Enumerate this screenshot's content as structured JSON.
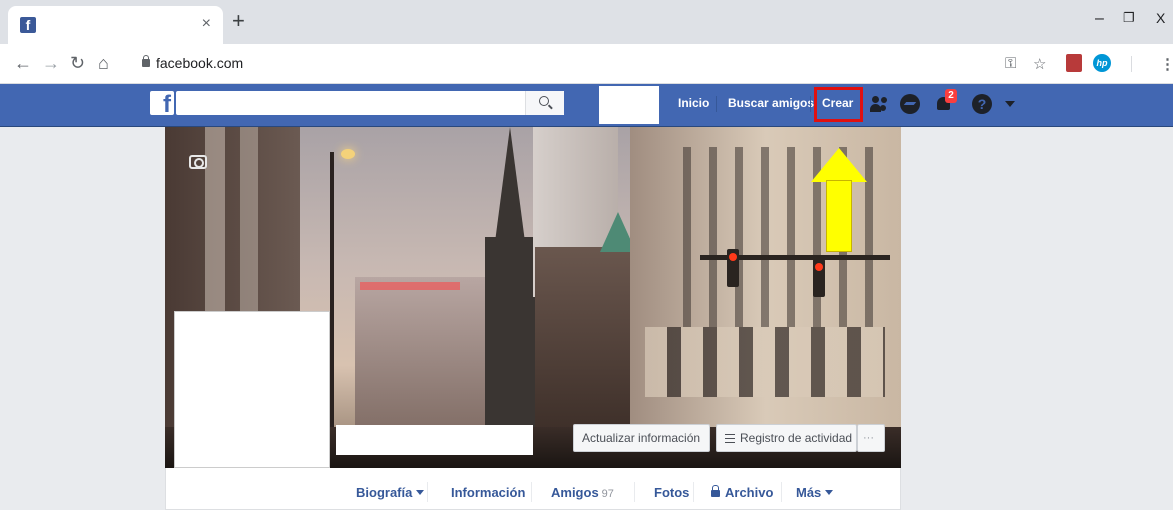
{
  "browser": {
    "tab_close": "×",
    "new_tab": "+",
    "url": "facebook.com",
    "window_minimize": "–",
    "window_restore": "❐",
    "window_close": "X"
  },
  "fb_header": {
    "logo": "f",
    "search_placeholder": "",
    "nav": {
      "home": "Inicio",
      "find_friends": "Buscar amigos",
      "create": "Crear"
    },
    "notifications_count": "2",
    "help": "?"
  },
  "cover": {
    "update_info_label": "Actualizar información",
    "activity_log_label": "Registro de actividad",
    "more_label": "···"
  },
  "profile_tabs": {
    "timeline": "Biografía",
    "about": "Información",
    "friends": "Amigos",
    "friends_count": "97",
    "photos": "Fotos",
    "archive": "Archivo",
    "more": "Más"
  },
  "colors": {
    "fb_blue": "#4267b2",
    "highlight_red": "#e01010",
    "arrow_yellow": "#ffff00",
    "link_blue": "#365899"
  }
}
